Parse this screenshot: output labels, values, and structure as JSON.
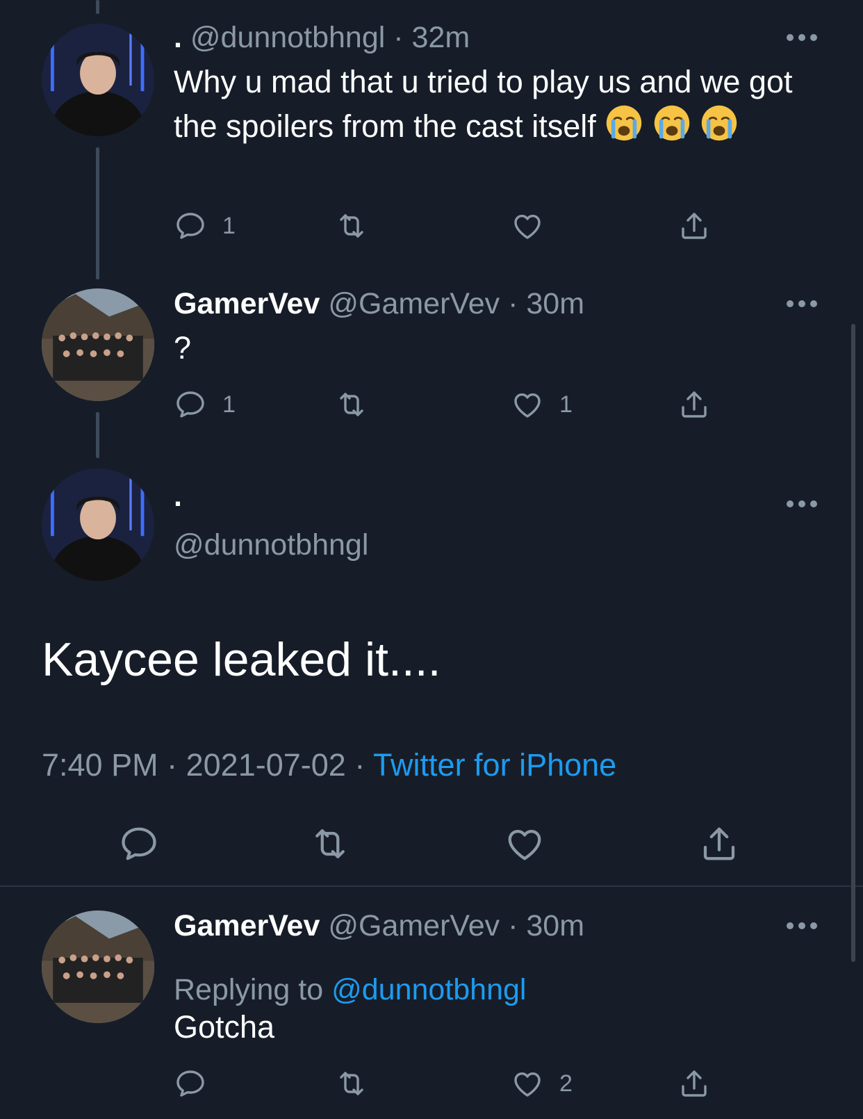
{
  "tweets": [
    {
      "display_name": ".",
      "handle": "@dunnotbhngl",
      "time": "· 32m",
      "text": "Why u mad that u tried to play us and we got the spoilers from the cast itself",
      "emojis": [
        "😭",
        "😭",
        "😭"
      ],
      "replies": "1",
      "retweets": "",
      "likes": ""
    },
    {
      "display_name": "GamerVev",
      "handle": "@GamerVev",
      "time": "· 30m",
      "text": "?",
      "replies": "1",
      "retweets": "",
      "likes": "1"
    }
  ],
  "main_tweet": {
    "display_name": ".",
    "handle": "@dunnotbhngl",
    "text": "Kaycee leaked it....",
    "time": "7:40 PM",
    "date": "2021-07-02",
    "separator": "·",
    "source": "Twitter for iPhone"
  },
  "reply": {
    "display_name": "GamerVev",
    "handle": "@GamerVev",
    "time": "· 30m",
    "replying_label": "Replying to",
    "replying_to": "@dunnotbhngl",
    "text": "Gotcha",
    "replies": "",
    "retweets": "",
    "likes": "2"
  },
  "icons": {
    "reply": "reply-icon",
    "retweet": "retweet-icon",
    "like": "heart-icon",
    "share": "share-icon",
    "more": "more-icon"
  },
  "colors": {
    "background": "#161d28",
    "text": "#ffffff",
    "muted": "#8b98a5",
    "link": "#1d9bf0",
    "thread_line": "#3d4a5a"
  }
}
